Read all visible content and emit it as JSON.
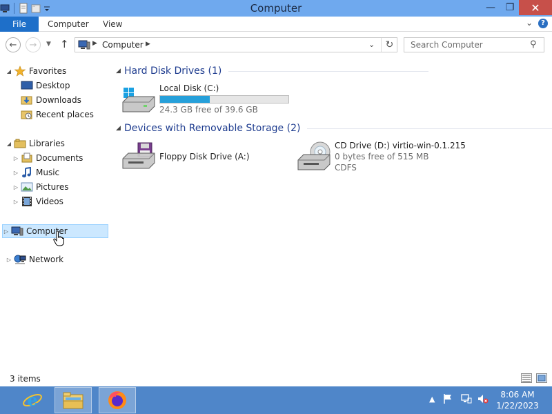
{
  "window": {
    "title": "Computer"
  },
  "ribbon": {
    "file_label": "File",
    "tabs": [
      "Computer",
      "View"
    ]
  },
  "address": {
    "path": [
      "Computer"
    ],
    "search_placeholder": "Search Computer"
  },
  "nav": {
    "favorites": {
      "label": "Favorites",
      "items": [
        "Desktop",
        "Downloads",
        "Recent places"
      ]
    },
    "libraries": {
      "label": "Libraries",
      "items": [
        "Documents",
        "Music",
        "Pictures",
        "Videos"
      ]
    },
    "computer": "Computer",
    "network": "Network"
  },
  "content": {
    "hard_disk_group": "Hard Disk Drives (1)",
    "removable_group": "Devices with Removable Storage (2)",
    "drives": {
      "local_disk": {
        "name": "Local Disk (C:)",
        "free_text": "24.3 GB free of 39.6 GB",
        "used_fraction": 0.386
      },
      "floppy": {
        "name": "Floppy Disk Drive (A:)"
      },
      "cd": {
        "name": "CD Drive (D:) virtio-win-0.1.215",
        "free_text": "0 bytes free of 515 MB",
        "filesystem": "CDFS"
      }
    }
  },
  "status": {
    "items": "3 items"
  },
  "taskbar": {
    "apps": [
      "internet-explorer",
      "file-explorer",
      "firefox"
    ],
    "time": "8:06 AM",
    "date": "1/22/2023"
  },
  "colors": {
    "titlebar": "#6fa9ee",
    "file_tab": "#1e6fc9",
    "taskbar": "#4f86c9",
    "group_header_text": "#1e3c8f",
    "usage_bar": "#26a0da",
    "selection": "#cce8ff"
  }
}
